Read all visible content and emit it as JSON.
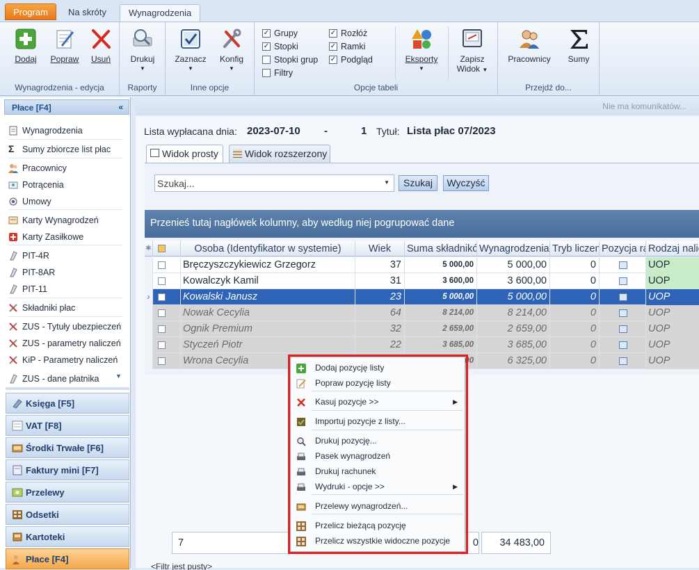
{
  "tabs": {
    "program": "Program",
    "shortcuts": "Na skróty",
    "payroll": "Wynagrodzenia"
  },
  "ribbon": {
    "edit_group": {
      "label": "Wynagrodzenia - edycja",
      "add": "Dodaj",
      "edit": "Popraw",
      "delete": "Usuń"
    },
    "reports_group": {
      "label": "Raporty",
      "print": "Drukuj"
    },
    "options_group": {
      "label": "Inne opcje",
      "mark": "Zaznacz",
      "config": "Konfig"
    },
    "table_group": {
      "label": "Opcje tabeli",
      "groups": "Grupy",
      "footers": "Stopki",
      "group_footers": "Stopki grup",
      "filters": "Filtry",
      "expand": "Rozłóż",
      "frames": "Ramki",
      "preview": "Podgląd",
      "exports": "Eksporty",
      "save_view": "Zapisz",
      "save_view2": "Widok"
    },
    "goto_group": {
      "label": "Przejdź do...",
      "employees": "Pracownicy",
      "sums": "Sumy"
    }
  },
  "sidebar": {
    "header": "Płace [F4]",
    "collapse": "«",
    "items": [
      "Wynagrodzenia",
      "Sumy zbiorcze list płac",
      "Pracownicy",
      "Potrącenia",
      "Umowy",
      "Karty Wynagrodzeń",
      "Karty Zasiłkowe",
      "PIT-4R",
      "PIT-8AR",
      "PIT-11",
      "Składniki płac",
      "ZUS - Tytuły ubezpieczeń",
      "ZUS - parametry naliczeń",
      "KiP - Parametry naliczeń",
      "ZUS - dane płatnika"
    ],
    "sections": [
      "Księga [F5]",
      "VAT [F8]",
      "Środki Trwałe [F6]",
      "Faktury mini [F7]",
      "Przelewy",
      "Odsetki",
      "Kartoteki",
      "Płace [F4]"
    ]
  },
  "messages": "Nie ma komunikatów...",
  "list": {
    "paid_label": "Lista wypłacana dnia:",
    "date": "2023-07-10",
    "dash": "-",
    "number": "1",
    "title_label": "Tytuł:",
    "title": "Lista płac 07/2023"
  },
  "view_tabs": {
    "simple": "Widok prosty",
    "extended": "Widok rozszerzony"
  },
  "search": {
    "placeholder": "Szukaj...",
    "search_btn": "Szukaj",
    "clear_btn": "Wyczyść"
  },
  "group_band": "Przenieś tutaj nagłówek kolumny, aby według niej pogrupować dane",
  "columns": [
    "Osoba (Identyfikator w systemie)",
    "Wiek",
    "Suma składników",
    "Wynagrodzenia",
    "Tryb liczenia",
    "Pozycja rachunku",
    "Rodzaj naliczenia"
  ],
  "rows": [
    {
      "name": "Bręczyszczykiewicz Grzegorz",
      "age": "37",
      "sum": "5 000,00",
      "salary": "5 000,00",
      "mode": "0",
      "type": "UOP",
      "state": "normal"
    },
    {
      "name": "Kowalczyk Kamil",
      "age": "31",
      "sum": "3 600,00",
      "salary": "3 600,00",
      "mode": "0",
      "type": "UOP",
      "state": "normal"
    },
    {
      "name": "Kowalski Janusz",
      "age": "23",
      "sum": "5 000,00",
      "salary": "5 000,00",
      "mode": "0",
      "type": "UOP",
      "state": "selected"
    },
    {
      "name": "Nowak Cecylia",
      "age": "64",
      "sum": "8 214,00",
      "salary": "8 214,00",
      "mode": "0",
      "type": "UOP",
      "state": "inactive"
    },
    {
      "name": "Ognik Premium",
      "age": "32",
      "sum": "2 659,00",
      "salary": "2 659,00",
      "mode": "0",
      "type": "UOP",
      "state": "inactive"
    },
    {
      "name": "Styczeń Piotr",
      "age": "22",
      "sum": "3 685,00",
      "salary": "3 685,00",
      "mode": "0",
      "type": "UOP",
      "state": "inactive"
    },
    {
      "name": "Wrona Cecylia",
      "age": "59",
      "sum": "6 325,00",
      "salary": "6 325,00",
      "mode": "0",
      "type": "UOP",
      "state": "inactive"
    }
  ],
  "footer": {
    "count": "7",
    "partial": "0",
    "total": "34 483,00",
    "filter_text": "<Filtr jest pusty>"
  },
  "context_menu": [
    {
      "label": "Dodaj pozycję listy",
      "icon": "add-icon"
    },
    {
      "label": "Popraw pozycję listy",
      "icon": "edit-icon"
    },
    {
      "label": "Kasuj pozycje >>",
      "icon": "delete-icon",
      "submenu": true
    },
    {
      "label": "Importuj pozycje z listy...",
      "icon": "import-icon"
    },
    {
      "label": "Drukuj pozycję...",
      "icon": "print-preview-icon"
    },
    {
      "label": "Pasek wynagrodzeń",
      "icon": "printer-icon"
    },
    {
      "label": "Drukuj rachunek",
      "icon": "printer-icon"
    },
    {
      "label": "Wydruki - opcje >>",
      "icon": "printer-icon",
      "submenu": true
    },
    {
      "label": "Przelewy wynagrodzeń...",
      "icon": "transfer-icon"
    },
    {
      "label": "Przelicz bieżącą pozycję",
      "icon": "calc-icon"
    },
    {
      "label": "Przelicz wszystkie widoczne pozycje",
      "icon": "calc-icon"
    }
  ]
}
